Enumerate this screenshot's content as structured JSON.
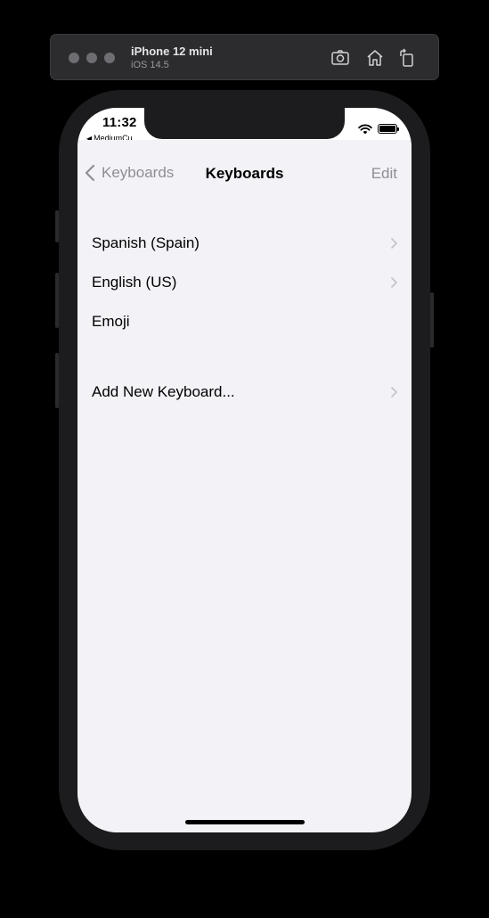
{
  "simulator": {
    "device_name": "iPhone 12 mini",
    "os_version": "iOS 14.5",
    "toolbar_icons": [
      "screenshot-icon",
      "home-icon",
      "rotate-icon"
    ]
  },
  "status_bar": {
    "time": "11:32",
    "back_app_label": "MediumCu..."
  },
  "nav": {
    "back_label": "Keyboards",
    "title": "Keyboards",
    "edit_label": "Edit"
  },
  "keyboards": {
    "items": [
      {
        "label": "Spanish (Spain)",
        "has_chevron": true
      },
      {
        "label": "English (US)",
        "has_chevron": true
      },
      {
        "label": "Emoji",
        "has_chevron": false
      }
    ],
    "add_label": "Add New Keyboard..."
  },
  "colors": {
    "background": "#f2f2f7",
    "text": "#000000",
    "secondary": "#8e8e93",
    "chevron": "#c4c4c7"
  }
}
